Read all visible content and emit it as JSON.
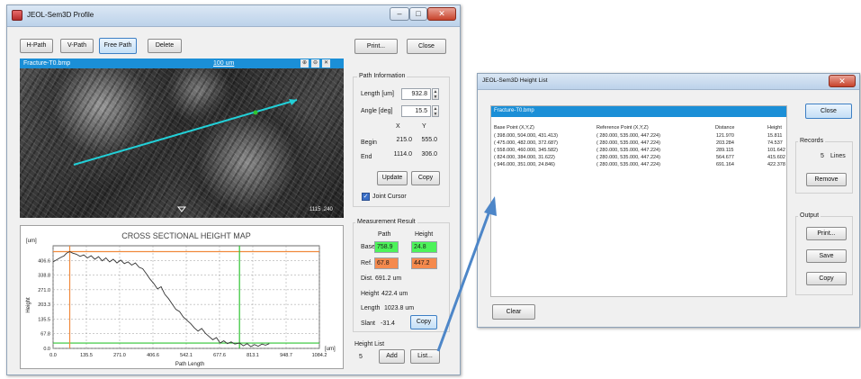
{
  "profile": {
    "title": "JEOL-Sem3D Profile",
    "path_buttons": [
      "H-Path",
      "V-Path",
      "Free Path"
    ],
    "delete_label": "Delete",
    "print_label": "Print...",
    "close_label": "Close",
    "image": {
      "filename": "Fracture-T0.bmp",
      "scale_label": "100 um",
      "counter": "1115 ,240"
    },
    "path_info": {
      "title": "Path Information",
      "length_label": "Length [um]",
      "length_value": "932.8",
      "angle_label": "Angle [deg]",
      "angle_value": "15.5",
      "x_header": "X",
      "y_header": "Y",
      "begin_label": "Begin",
      "begin_x": "215.0",
      "begin_y": "555.0",
      "end_label": "End",
      "end_x": "1114.0",
      "end_y": "306.0",
      "update_label": "Update",
      "copy_label": "Copy",
      "joint_cursor_label": "Joint Cursor",
      "joint_cursor_checked": true
    },
    "measurement": {
      "title": "Measurement Result",
      "path_header": "Path",
      "height_header": "Height",
      "base_label": "Base",
      "base_path": "758.9",
      "base_height": "24.8",
      "ref_label": "Ref.",
      "ref_path": "67.8",
      "ref_height": "447.2",
      "dist_label": "Dist.",
      "dist_value": "691.2 um",
      "height_label": "Height",
      "height_value": "422.4 um",
      "length_label": "Length",
      "length_value": "1023.8 um",
      "slant_label": "Slant",
      "slant_value": "-31.4",
      "copy_label": "Copy"
    },
    "height_list": {
      "title": "Height List",
      "count": "5",
      "add_label": "Add",
      "list_label": "List..."
    }
  },
  "chart_data": {
    "type": "line",
    "title": "CROSS SECTIONAL HEIGHT MAP",
    "xlabel": "Path Length",
    "ylabel": "Height",
    "x_unit": "[um]",
    "y_unit": "[um]",
    "xlim": [
      0,
      1084.2
    ],
    "ylim": [
      0,
      474.3
    ],
    "xticks": [
      "0.0",
      "135.5",
      "271.0",
      "406.6",
      "542.1",
      "677.6",
      "813.1",
      "948.7",
      "1084.2"
    ],
    "yticks": [
      "0.0",
      "67.8",
      "135.5",
      "203.3",
      "271.0",
      "338.8",
      "406.6"
    ],
    "grid": true,
    "series": [
      {
        "x": [
          0,
          15,
          30,
          45,
          55,
          67.8,
          80,
          95,
          110,
          125,
          140,
          155,
          170,
          185,
          200,
          215,
          230,
          245,
          260,
          275,
          290,
          305,
          320,
          335,
          350,
          365,
          380,
          395,
          410,
          425,
          440,
          455,
          470,
          485,
          500,
          515,
          530,
          545,
          560,
          575,
          590,
          605,
          620,
          635,
          650,
          665,
          680,
          695,
          710,
          725,
          740,
          758.9,
          775,
          790,
          805,
          820,
          835,
          850,
          865,
          880
        ],
        "y": [
          400,
          410,
          420,
          428,
          440,
          447.2,
          440,
          435,
          425,
          432,
          418,
          428,
          412,
          424,
          405,
          418,
          400,
          412,
          395,
          408,
          392,
          400,
          385,
          395,
          375,
          368,
          345,
          320,
          300,
          275,
          285,
          250,
          230,
          205,
          180,
          170,
          145,
          130,
          115,
          95,
          80,
          92,
          70,
          55,
          40,
          50,
          25,
          35,
          22,
          30,
          20,
          24.8,
          12,
          22,
          8,
          18,
          10,
          20,
          15,
          22
        ]
      }
    ],
    "cursors": [
      {
        "x": 67.8,
        "color": "#f08a3c"
      },
      {
        "x": 758.9,
        "color": "#2fc433"
      }
    ],
    "hlines": [
      {
        "y": 447.2,
        "color": "#f08a3c"
      },
      {
        "y": 24.8,
        "color": "#2fc433"
      }
    ]
  },
  "heightlist": {
    "title": "JEOL-Sem3D Height List",
    "filename": "Fracture-T0.bmp",
    "columns": [
      "Base Point (X,Y,Z)",
      "Reference Point (X,Y,Z)",
      "Distance",
      "Height"
    ],
    "rows": [
      [
        "( 398.000,   504.000,   431.413)",
        "( 280.000,   535.000,   447.224)",
        "121.970",
        "15.811"
      ],
      [
        "( 475.000,   482.000,   372.687)",
        "( 280.000,   535.000,   447.224)",
        "203.284",
        "74.537"
      ],
      [
        "( 558.000,   460.000,   345.582)",
        "( 280.000,   535.000,   447.224)",
        "289.115",
        "101.642"
      ],
      [
        "( 824.000,   384.000,   31.622)",
        "( 280.000,   535.000,   447.224)",
        "564.677",
        "415.602"
      ],
      [
        "( 946.000,   351.000,   24.846)",
        "( 280.000,   535.000,   447.224)",
        "691.164",
        "422.378"
      ]
    ],
    "close_label": "Close",
    "records_title": "Records",
    "records_count": "5",
    "records_unit": "Lines",
    "remove_label": "Remove",
    "output_title": "Output",
    "print_label": "Print...",
    "save_label": "Save",
    "copy_label": "Copy",
    "clear_label": "Clear"
  },
  "colors": {
    "accent_blue": "#1b8fd7",
    "base_green": "#4cf35a",
    "ref_orange": "#f58a4e",
    "path_cyan": "#22d0d8",
    "arrow_blue": "#4d86c8"
  }
}
